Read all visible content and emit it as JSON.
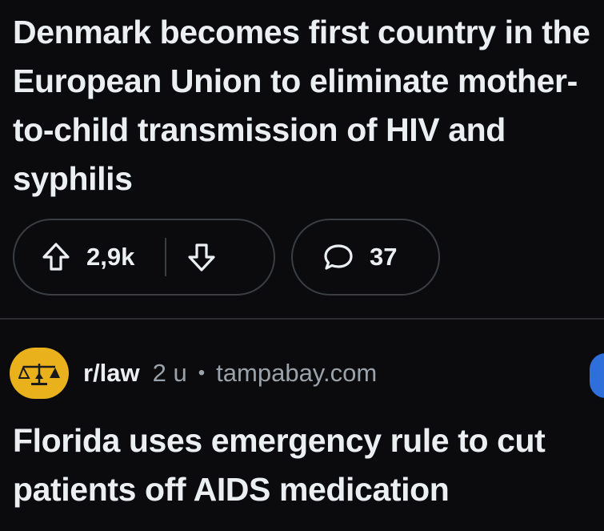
{
  "post1": {
    "title": "Denmark becomes first country in the European Union to eliminate mother-to-child transmission of HIV and syphilis",
    "upvote_icon": "arrow-up-outline-icon",
    "vote_count": "2,9k",
    "downvote_icon": "arrow-down-outline-icon",
    "comment_icon": "speech-bubble-icon",
    "comment_count": "37"
  },
  "post2": {
    "avatar_icon": "scales-of-justice-icon",
    "subreddit": "r/law",
    "age": "2 u",
    "dot": "•",
    "domain": "tampabay.com",
    "title": "Florida uses emergency rule to cut patients off AIDS medication"
  },
  "colors": {
    "background": "#0b0b0d",
    "text": "#eceff2",
    "meta_text": "#9aa3ab",
    "pill_border": "#3a3d41",
    "avatar_bg": "#e9b21d",
    "edge_blue": "#2f6fdc"
  }
}
